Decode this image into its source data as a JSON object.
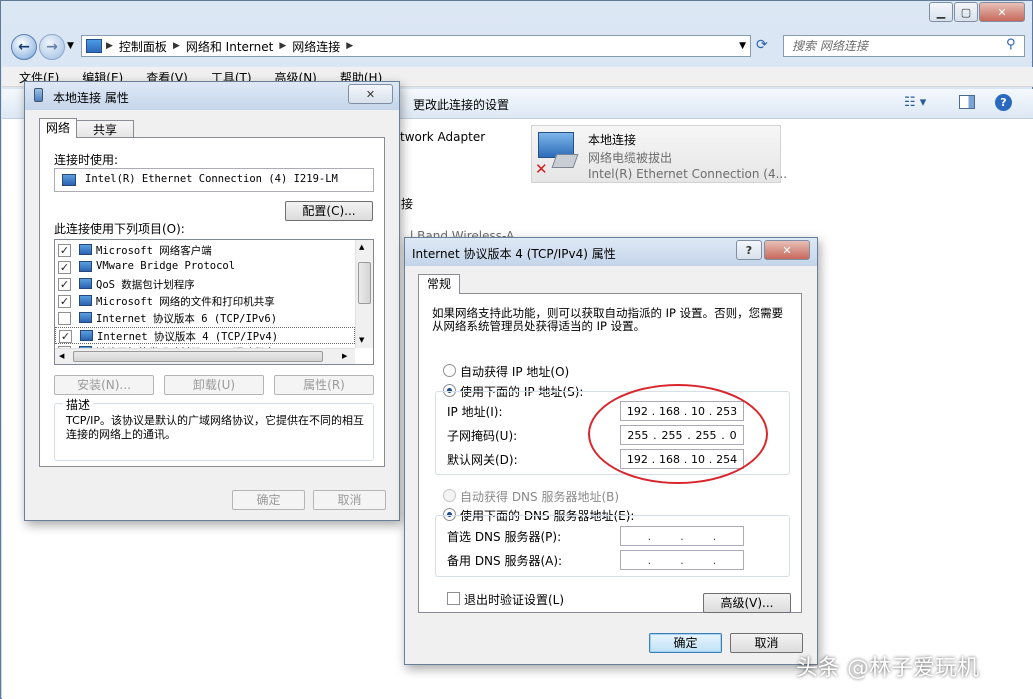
{
  "explorer": {
    "address": [
      "控制面板",
      "网络和 Internet",
      "网络连接"
    ],
    "search_placeholder": "搜索 网络连接",
    "menu": [
      "文件(F)",
      "编辑(E)",
      "查看(V)",
      "工具(T)",
      "高级(N)",
      "帮助(H)"
    ],
    "cmd_change": "更改此连接的设置",
    "adapter_fragment": "twork Adapter",
    "wireless_fragment": "l Band Wireless-A",
    "conn": {
      "name": "本地连接",
      "status": "网络电缆被拔出",
      "device": "Intel(R) Ethernet Connection (4..."
    }
  },
  "props": {
    "title": "本地连接 属性",
    "tabs": [
      "网络",
      "共享"
    ],
    "connect_using_label": "连接时使用:",
    "adapter_name": "Intel(R) Ethernet Connection (4) I219-LM",
    "configure_btn": "配置(C)...",
    "items_label": "此连接使用下列项目(O):",
    "items": [
      {
        "label": "Microsoft 网络客户端",
        "checked": true
      },
      {
        "label": "VMware Bridge Protocol",
        "checked": true
      },
      {
        "label": "QoS 数据包计划程序",
        "checked": true
      },
      {
        "label": "Microsoft 网络的文件和打印机共享",
        "checked": true
      },
      {
        "label": "Internet 协议版本 6 (TCP/IPv6)",
        "checked": false
      },
      {
        "label": "Internet 协议版本 4 (TCP/IPv4)",
        "checked": true
      },
      {
        "label": "链路层拓扑发现映射器 I/O 驱动程序",
        "checked": true
      }
    ],
    "install_btn": "安装(N)...",
    "uninstall_btn": "卸载(U)",
    "properties_btn": "属性(R)",
    "description_title": "描述",
    "description": "TCP/IP。该协议是默认的广域网络协议，它提供在不同的相互连接的网络上的通讯。",
    "ok_btn": "确定",
    "cancel_btn": "取消"
  },
  "ipv4": {
    "title": "Internet 协议版本 4 (TCP/IPv4) 属性",
    "help": "?",
    "tab": "常规",
    "info": "如果网络支持此功能，则可以获取自动指派的 IP 设置。否则，您需要从网络系统管理员处获得适当的 IP 设置。",
    "auto_ip": "自动获得 IP 地址(O)",
    "use_ip": "使用下面的 IP 地址(S):",
    "ip_label": "IP 地址(I):",
    "ip": [
      "192",
      "168",
      "10",
      "253"
    ],
    "mask_label": "子网掩码(U):",
    "mask": [
      "255",
      "255",
      "255",
      "0"
    ],
    "gw_label": "默认网关(D):",
    "gw": [
      "192",
      "168",
      "10",
      "254"
    ],
    "auto_dns": "自动获得 DNS 服务器地址(B)",
    "use_dns": "使用下面的 DNS 服务器地址(E):",
    "dns1_label": "首选 DNS 服务器(P):",
    "dns2_label": "备用 DNS 服务器(A):",
    "validate_label": "退出时验证设置(L)",
    "validate_checked": false,
    "advanced_btn": "高级(V)...",
    "ok_btn": "确定",
    "cancel_btn": "取消"
  },
  "watermark": "头条 @林子爱玩机",
  "colors": {
    "highlight_ellipse": "#d9262c",
    "title_bar": "#c4d5ea"
  }
}
